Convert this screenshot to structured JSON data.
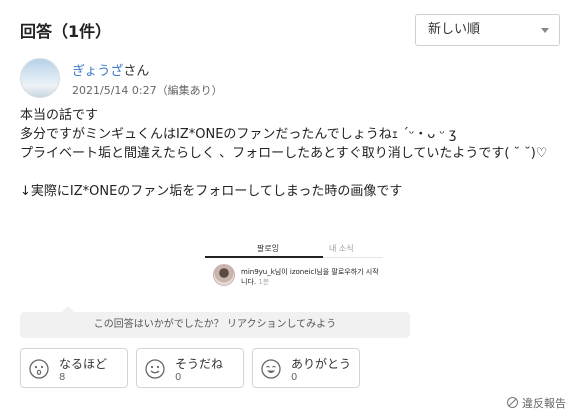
{
  "header": {
    "title": "回答（1件）",
    "sort_value": "新しい順"
  },
  "answer": {
    "username": "ぎょうざ",
    "honorific": "さん",
    "date": "2021/5/14 0:27（編集あり）",
    "lines": [
      "本当の話です",
      "多分ですがミンギュくんはIZ*ONEのファンだったんでしょうねｪ ´ᵕ・ᴗ ᵕ ʒ",
      "プライベート垢と間違えたらしく 、フォローしたあとすぐ取り消していたようです(  ˘ ˘)♡",
      "",
      "↓実際にIZ*ONEのファン垢をフォローしてしまった時の画像です"
    ]
  },
  "embed": {
    "tab_following": "팔로잉",
    "tab_news": "내 소식",
    "notice": "min9yu_k님이 izoneicl님을 팔로우하기 시작",
    "notice_cont": "니다.",
    "ago": "1분"
  },
  "reaction_prompt": "この回答はいかがでしたか？ リアクションしてみよう",
  "reactions": [
    {
      "label": "なるほど",
      "count": "8",
      "icon": "surprised-face-icon"
    },
    {
      "label": "そうだね",
      "count": "0",
      "icon": "smile-face-icon"
    },
    {
      "label": "ありがとう",
      "count": "0",
      "icon": "grin-face-icon"
    }
  ],
  "report_label": "違反報告"
}
